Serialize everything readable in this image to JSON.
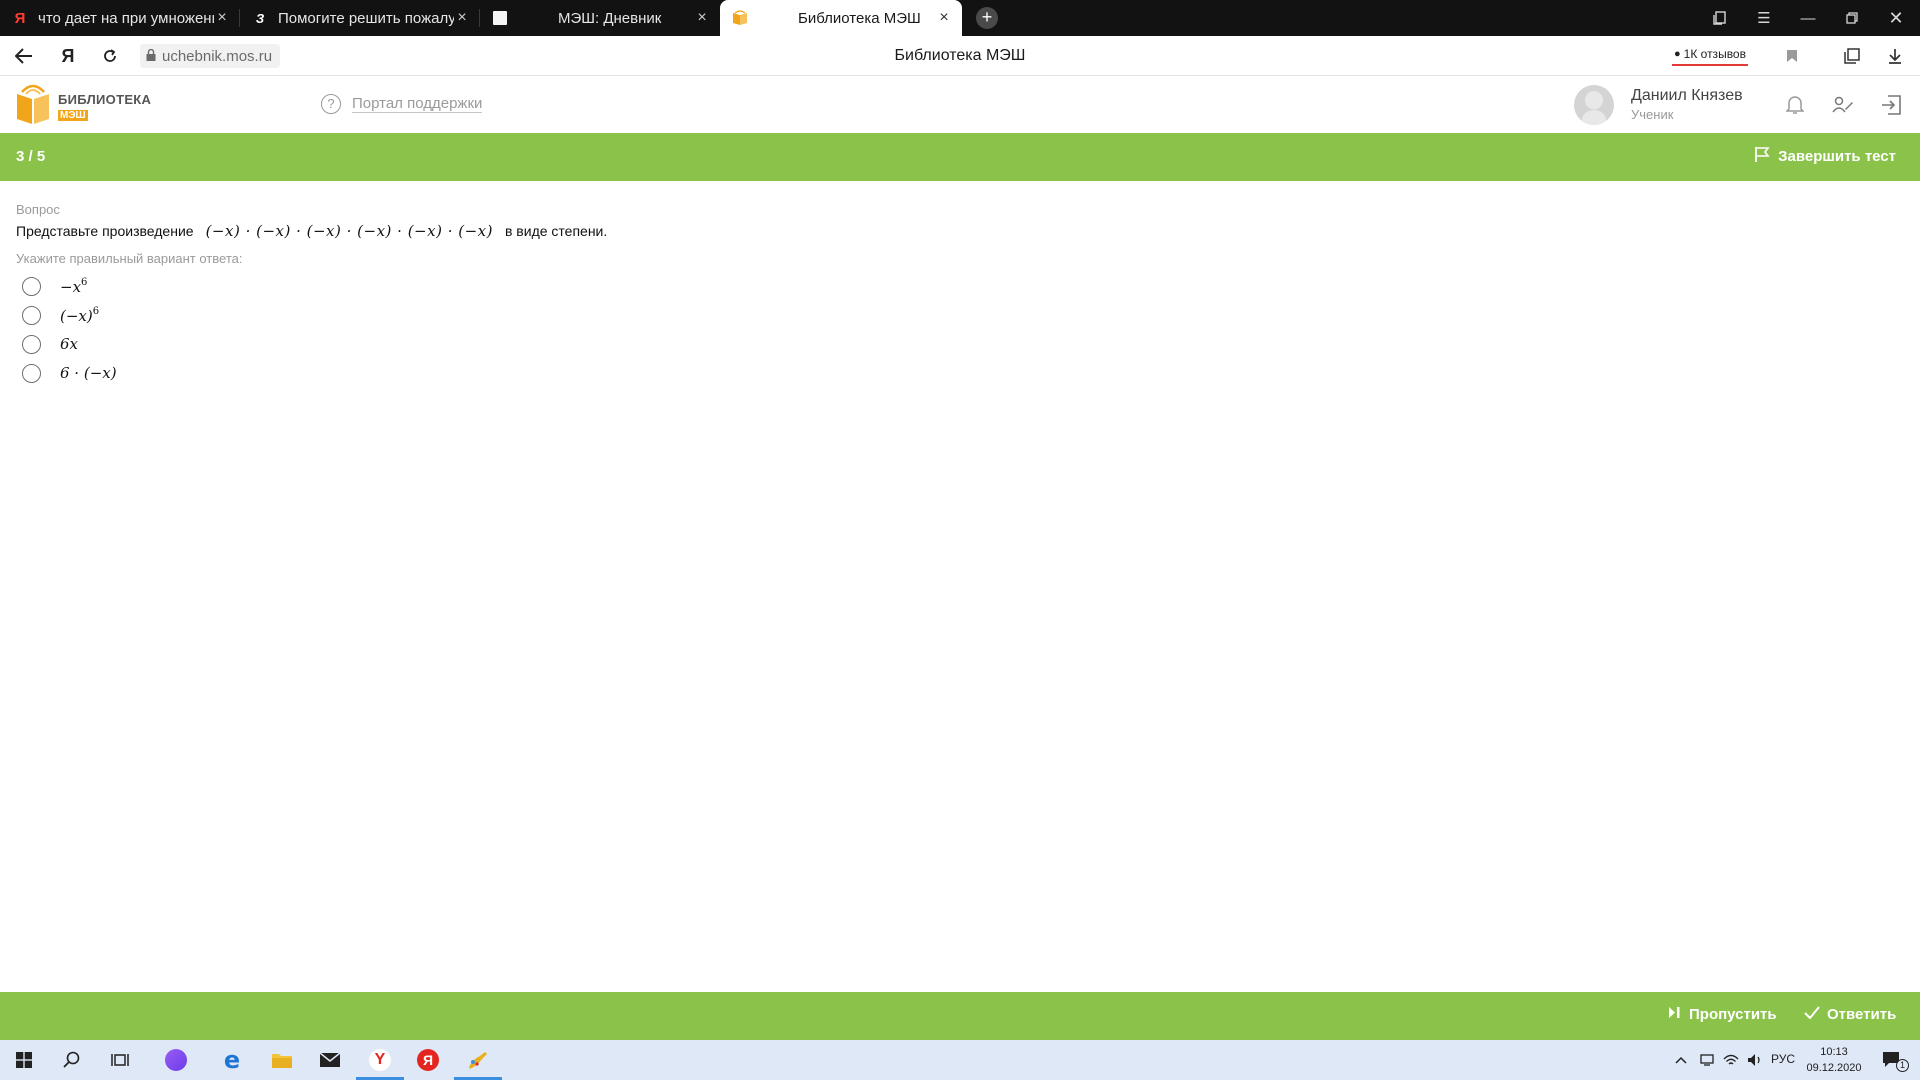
{
  "browser": {
    "tabs": [
      {
        "title": "что дает на при умножении",
        "favicon": "yandex-icon"
      },
      {
        "title": "Помогите решить пожалуйста",
        "favicon": "znanija-icon"
      },
      {
        "title": "МЭШ: Дневник",
        "favicon": "page-icon"
      },
      {
        "title": "Библиотека МЭШ",
        "favicon": "library-book-icon",
        "active": true
      }
    ],
    "url": "uchebnik.mos.ru",
    "page_title": "Библиотека МЭШ",
    "reviews_label": "1К отзывов"
  },
  "site": {
    "logo_line1": "БИБЛИОТЕКА",
    "logo_line2": "МЭШ",
    "support_label": "Портал поддержки",
    "user_name": "Даниил Князев",
    "user_role": "Ученик"
  },
  "test": {
    "progress": "3 / 5",
    "finish_label": "Завершить тест",
    "question_label": "Вопрос",
    "question_prefix": "Представьте произведение",
    "question_expression": "(−x) · (−x) · (−x) · (−x) · (−x) · (−x)",
    "question_suffix": "в виде степени.",
    "hint": "Укажите правильный вариант ответа:",
    "options": [
      {
        "base": "−x",
        "exp": "6"
      },
      {
        "base": "(−x)",
        "exp": "6"
      },
      {
        "base": "6x",
        "exp": ""
      },
      {
        "base": "6 · (−x)",
        "exp": ""
      }
    ],
    "skip_label": "Пропустить",
    "answer_label": "Ответить"
  },
  "taskbar": {
    "lang": "РУС",
    "time": "10:13",
    "date": "09.12.2020",
    "notifications": "1"
  },
  "colors": {
    "accent_green": "#8bc34a",
    "logo_orange": "#f0a51a",
    "tabstrip": "#121212"
  }
}
